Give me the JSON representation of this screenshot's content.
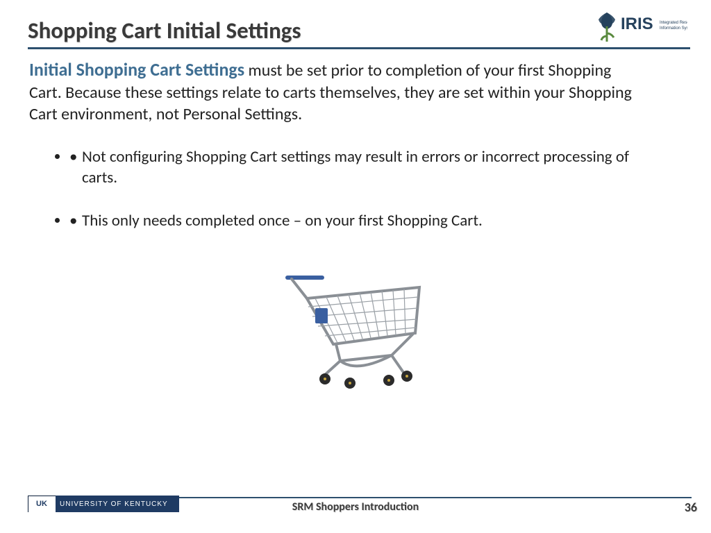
{
  "header": {
    "title": "Shopping Cart Initial Settings",
    "logo": {
      "name": "IRIS",
      "tagline": "Integrated Resource Information System"
    }
  },
  "body": {
    "lead_accent": "Initial Shopping Cart Settings",
    "lead_rest": " must be set prior to completion of your first Shopping Cart. Because these settings relate to carts themselves, they are set within your Shopping Cart environment, not Personal Settings.",
    "bullets": [
      "Not configuring Shopping Cart settings may result in errors or incorrect processing of carts.",
      "This only needs completed once – on your first Shopping Cart."
    ]
  },
  "footer": {
    "org_mark": "UK",
    "org_name": "UNIVERSITY OF KENTUCKY",
    "deck_title": "SRM Shoppers Introduction",
    "page": "36"
  }
}
